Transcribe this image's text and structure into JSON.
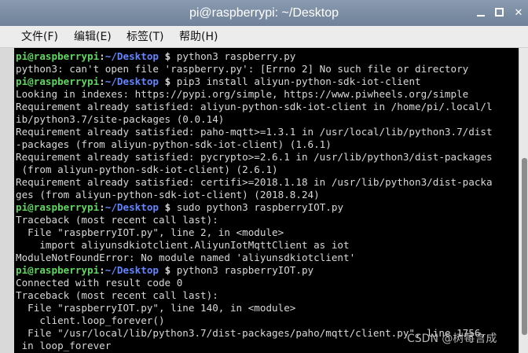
{
  "window": {
    "title": "pi@raspberrypi: ~/Desktop",
    "minimize": "",
    "maximize": "",
    "close": "✕"
  },
  "menu": {
    "items": [
      "文件(F)",
      "编辑(E)",
      "标签(T)",
      "帮助(H)"
    ]
  },
  "prompt": {
    "user": "pi@raspberrypi",
    "sep": ":",
    "path": "~/Desktop",
    "symbol": " $ "
  },
  "lines": [
    {
      "type": "prompt",
      "cmd": "python3 raspberry.py"
    },
    {
      "type": "out",
      "text": "python3: can't open file 'raspberry.py': [Errno 2] No such file or directory"
    },
    {
      "type": "prompt",
      "cmd": "pip3 install aliyun-python-sdk-iot-client"
    },
    {
      "type": "out",
      "text": "Looking in indexes: https://pypi.org/simple, https://www.piwheels.org/simple"
    },
    {
      "type": "out",
      "text": "Requirement already satisfied: aliyun-python-sdk-iot-client in /home/pi/.local/l"
    },
    {
      "type": "out",
      "text": "ib/python3.7/site-packages (0.0.14)"
    },
    {
      "type": "out",
      "text": "Requirement already satisfied: paho-mqtt>=1.3.1 in /usr/local/lib/python3.7/dist"
    },
    {
      "type": "out",
      "text": "-packages (from aliyun-python-sdk-iot-client) (1.6.1)"
    },
    {
      "type": "out",
      "text": "Requirement already satisfied: pycrypto>=2.6.1 in /usr/lib/python3/dist-packages"
    },
    {
      "type": "out",
      "text": " (from aliyun-python-sdk-iot-client) (2.6.1)"
    },
    {
      "type": "out",
      "text": "Requirement already satisfied: certifi>=2018.1.18 in /usr/lib/python3/dist-packa"
    },
    {
      "type": "out",
      "text": "ges (from aliyun-python-sdk-iot-client) (2018.8.24)"
    },
    {
      "type": "prompt",
      "cmd": "sudo python3 raspberryIOT.py"
    },
    {
      "type": "out",
      "text": "Traceback (most recent call last):"
    },
    {
      "type": "out",
      "text": "  File \"raspberryIOT.py\", line 2, in <module>"
    },
    {
      "type": "out",
      "text": "    import aliyunsdkiotclient.AliyunIotMqttClient as iot"
    },
    {
      "type": "out",
      "text": "ModuleNotFoundError: No module named 'aliyunsdkiotclient'"
    },
    {
      "type": "prompt",
      "cmd": "python3 raspberryIOT.py"
    },
    {
      "type": "out",
      "text": "Connected with result code 0"
    },
    {
      "type": "out",
      "text": "Traceback (most recent call last):"
    },
    {
      "type": "out",
      "text": "  File \"raspberryIOT.py\", line 140, in <module>"
    },
    {
      "type": "out",
      "text": "    client.loop_forever()"
    },
    {
      "type": "out",
      "text": "  File \"/usr/local/lib/python3.7/dist-packages/paho/mqtt/client.py\", line 1756,"
    },
    {
      "type": "out",
      "text": " in loop_forever"
    }
  ],
  "watermark": "CSDN @树莓言成"
}
